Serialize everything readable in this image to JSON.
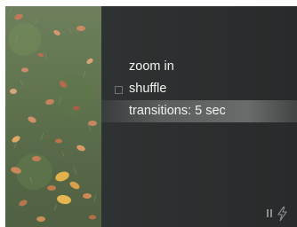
{
  "menu": {
    "items": [
      {
        "label": "zoom in",
        "checkbox": false,
        "selected": false
      },
      {
        "label": "shuffle",
        "checkbox": true,
        "selected": false
      },
      {
        "label": "transitions: 5 sec",
        "checkbox": false,
        "selected": true
      }
    ]
  },
  "icons": {
    "status_left": "pause-icon",
    "status_right": "lightning-bolt-icon"
  },
  "colors": {
    "panel_background": "#2b2e2e",
    "menu_text": "#f2f2f2",
    "highlight": "#6a6d6d"
  }
}
